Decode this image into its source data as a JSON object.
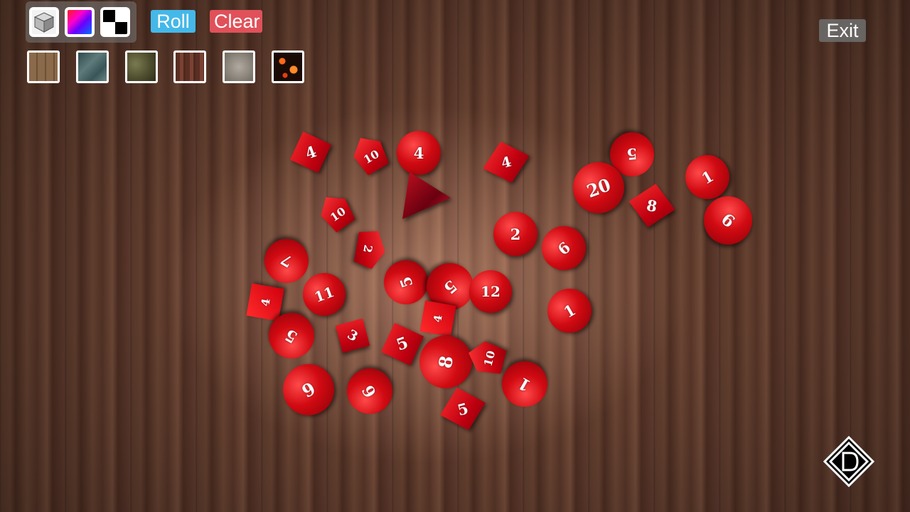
{
  "toolbar": {
    "swatches": [
      "cube-icon",
      "color-gradient-icon",
      "checker-icon"
    ],
    "roll_label": "Roll",
    "clear_label": "Clear",
    "exit_label": "Exit",
    "textures": [
      "wood-tile",
      "teal-stone",
      "mossy-stone",
      "dark-wood",
      "gray-stone",
      "lava"
    ]
  },
  "colors": {
    "roll_button": "#44b8e8",
    "clear_button": "#e0515a",
    "dice_red": "#d10a12",
    "table_wood": "#6b4232"
  },
  "dice": [
    {
      "type": "d8",
      "value": "4"
    },
    {
      "type": "d10",
      "value": "10"
    },
    {
      "type": "d20",
      "value": "4"
    },
    {
      "type": "d8",
      "value": "4"
    },
    {
      "type": "d20",
      "value": "5"
    },
    {
      "type": "d20",
      "value": "20"
    },
    {
      "type": "d20",
      "value": "1"
    },
    {
      "type": "tri",
      "value": ""
    },
    {
      "type": "d10",
      "value": "10"
    },
    {
      "type": "d8",
      "value": "8"
    },
    {
      "type": "d20",
      "value": "6"
    },
    {
      "type": "d10",
      "value": "2"
    },
    {
      "type": "d20",
      "value": "2"
    },
    {
      "type": "d20",
      "value": "6"
    },
    {
      "type": "d20",
      "value": "7"
    },
    {
      "type": "d20",
      "value": "11"
    },
    {
      "type": "d20",
      "value": "5"
    },
    {
      "type": "d20",
      "value": "5"
    },
    {
      "type": "d20",
      "value": "12"
    },
    {
      "type": "sq",
      "value": "4"
    },
    {
      "type": "d20",
      "value": "1"
    },
    {
      "type": "sq",
      "value": "4"
    },
    {
      "type": "d20",
      "value": "5"
    },
    {
      "type": "d4",
      "value": "3"
    },
    {
      "type": "d8",
      "value": "5"
    },
    {
      "type": "d20",
      "value": "8"
    },
    {
      "type": "d10",
      "value": "10"
    },
    {
      "type": "d20",
      "value": "9"
    },
    {
      "type": "d20",
      "value": "6"
    },
    {
      "type": "d20",
      "value": "1"
    },
    {
      "type": "d8",
      "value": "5"
    }
  ],
  "logo": "d-logo-icon"
}
